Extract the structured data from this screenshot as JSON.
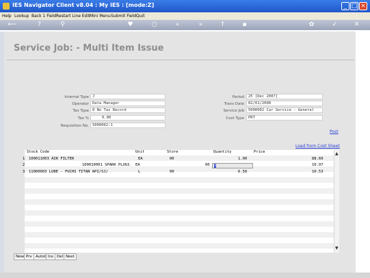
{
  "window": {
    "title": "IES Navigator Client v8.04 : My IES :      [mode:Z]"
  },
  "menu": [
    "Help",
    "Lookup",
    "Back 1 Field",
    "Restart Line Edit",
    "Mini Menu",
    "Submit Field",
    "Quit"
  ],
  "page_title": "Service Job: - Multi Item Issue",
  "form": {
    "internal_type": {
      "label": "Internal Type",
      "value": "J"
    },
    "operator": {
      "label": "Operator",
      "value": "Data Manager"
    },
    "tax_type": {
      "label": "Tax Type",
      "value": "0 No Tax Record"
    },
    "tax_pct": {
      "label": "Tax %",
      "value": "0.00"
    },
    "requisition": {
      "label": "Requisition No.",
      "value": "5000002:1"
    },
    "period": {
      "label": "Period",
      "value": "25  [Dec 2007]"
    },
    "trans_date": {
      "label": "Trans Date",
      "value": "02/01/2008"
    },
    "service_job": {
      "label": "Service Job",
      "value": "5000002 Car Service - General"
    },
    "cost_type": {
      "label": "Cost Type",
      "value": "PRT"
    }
  },
  "links": {
    "post": "Post",
    "load_cost_sheet": "Load from Cost Sheet"
  },
  "grid": {
    "headers": [
      "Stock Code",
      "Unit",
      "Store",
      "Quantity",
      "Price"
    ],
    "rows": [
      {
        "num": "1",
        "code": "100011003 AIR FILTER",
        "unit": "EA",
        "store": "00",
        "qty": "1.00",
        "price": "88.60"
      },
      {
        "num": "2",
        "code": "100010001 SPARK PLUGS",
        "unit": "EA",
        "store": "00",
        "qty": "",
        "price": "10.97"
      },
      {
        "num": "3",
        "code": "11000003 LUBE - FUCHS TITAN API/SJ/",
        "unit": "L",
        "store": "00",
        "qty": "6.50",
        "price": "10.53"
      }
    ],
    "edit_value": "1"
  },
  "bottom_buttons": [
    "New",
    "Prv",
    "AutoC",
    "Ins",
    "Del",
    "Next"
  ],
  "colors": {
    "link": "#2a3fd6",
    "titlebar": "#1f56c9",
    "title_text": "#8e8e8e"
  }
}
